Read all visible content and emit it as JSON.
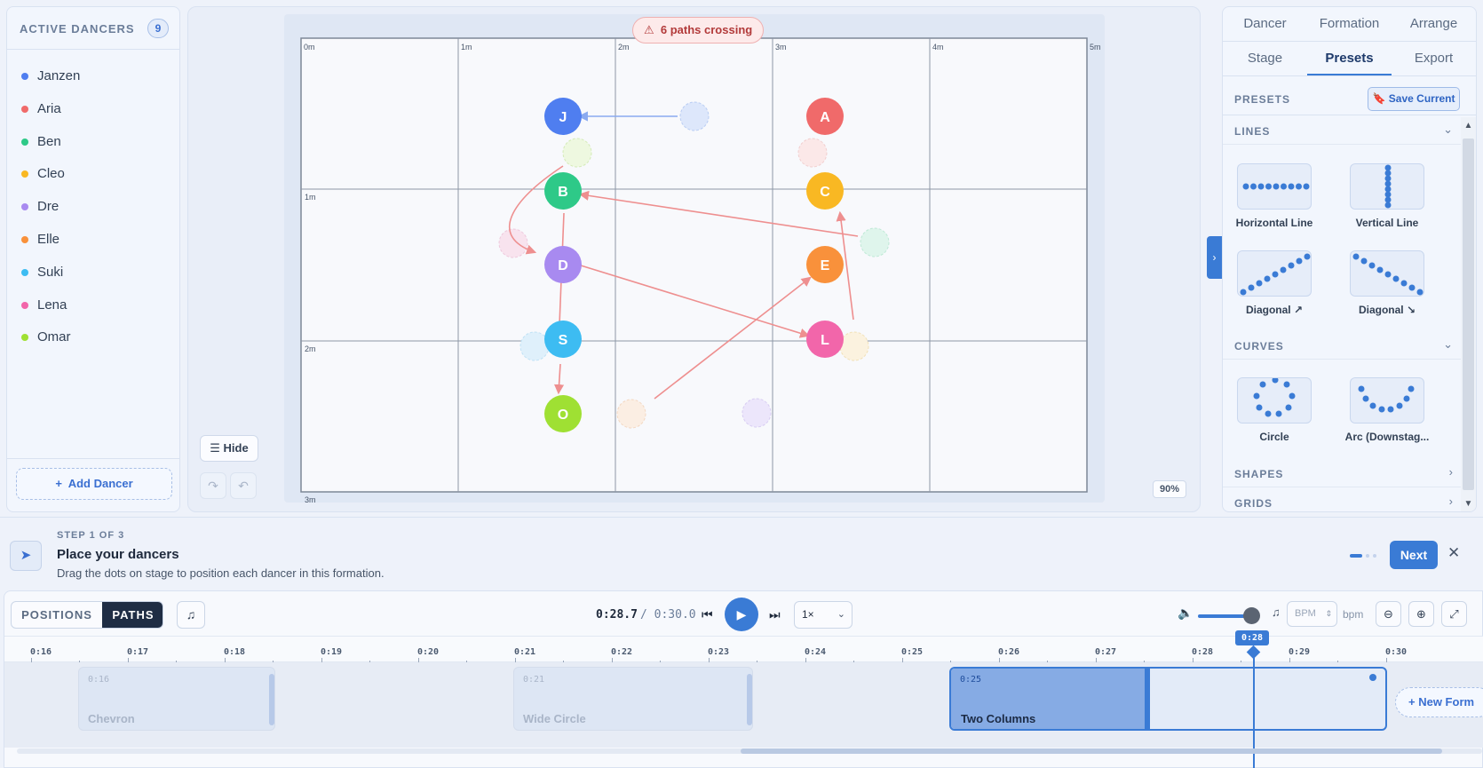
{
  "dancers_panel": {
    "title": "ACTIVE DANCERS",
    "count": "9",
    "add_label": "Add Dancer",
    "dancers": [
      {
        "name": "Janzen",
        "color": "#4f7ef0"
      },
      {
        "name": "Aria",
        "color": "#f06a6a"
      },
      {
        "name": "Ben",
        "color": "#2ec988"
      },
      {
        "name": "Cleo",
        "color": "#f9b823"
      },
      {
        "name": "Dre",
        "color": "#a88af0"
      },
      {
        "name": "Elle",
        "color": "#f9913b"
      },
      {
        "name": "Suki",
        "color": "#3dbcf2"
      },
      {
        "name": "Lena",
        "color": "#f266aa"
      },
      {
        "name": "Omar",
        "color": "#9fe033"
      }
    ]
  },
  "stage": {
    "crossing_warning": "6 paths crossing",
    "hide_label": "Hide",
    "zoom": "90%",
    "x_labels": [
      "0m",
      "1m",
      "2m",
      "3m",
      "4m",
      "5m"
    ],
    "y_labels": [
      "1m",
      "2m",
      "3m"
    ],
    "markers": [
      {
        "letter": "J",
        "color": "#4f7ef0"
      },
      {
        "letter": "A",
        "color": "#f06a6a"
      },
      {
        "letter": "B",
        "color": "#2ec988"
      },
      {
        "letter": "C",
        "color": "#f9b823"
      },
      {
        "letter": "D",
        "color": "#a88af0"
      },
      {
        "letter": "E",
        "color": "#f9913b"
      },
      {
        "letter": "S",
        "color": "#3dbcf2"
      },
      {
        "letter": "L",
        "color": "#f266aa"
      },
      {
        "letter": "O",
        "color": "#9fe033"
      }
    ]
  },
  "right_panel": {
    "tabs_top": [
      "Dancer",
      "Formation",
      "Arrange"
    ],
    "tabs_bottom": [
      "Stage",
      "Presets",
      "Export"
    ],
    "active_tab": "Presets",
    "presets_label": "PRESETS",
    "save_current_label": "Save Current",
    "sections": {
      "lines": "LINES",
      "curves": "CURVES",
      "shapes": "SHAPES",
      "grids": "GRIDS"
    },
    "presets": {
      "horizontal": "Horizontal Line",
      "vertical": "Vertical Line",
      "diag_up": "Diagonal ↗",
      "diag_down": "Diagonal ↘",
      "circle": "Circle",
      "arc": "Arc (Downstag..."
    }
  },
  "guide": {
    "step": "STEP 1 OF 3",
    "title": "Place your dancers",
    "description": "Drag the dots on stage to position each dancer in this formation.",
    "next_label": "Next",
    "total_steps": 3,
    "current_step": 1
  },
  "timeline": {
    "mode_positions": "POSITIONS",
    "mode_paths": "PATHS",
    "active_mode": "PATHS",
    "current_time": "0:28.7",
    "total_time": "/ 0:30.0",
    "speed": "1×",
    "bpm_placeholder": "BPM",
    "bpm_unit": "bpm",
    "playhead_label": "0:28",
    "ticks": [
      "0:16",
      "0:17",
      "0:18",
      "0:19",
      "0:20",
      "0:21",
      "0:22",
      "0:23",
      "0:24",
      "0:25",
      "0:26",
      "0:27",
      "0:28",
      "0:29",
      "0:30"
    ],
    "formations": [
      {
        "time": "0:16",
        "name": "Chevron"
      },
      {
        "time": "0:21",
        "name": "Wide Circle"
      },
      {
        "time": "0:25",
        "name": "Two Columns"
      }
    ],
    "new_formation_label": "New Form"
  },
  "accent_color": "#3a7bd5"
}
